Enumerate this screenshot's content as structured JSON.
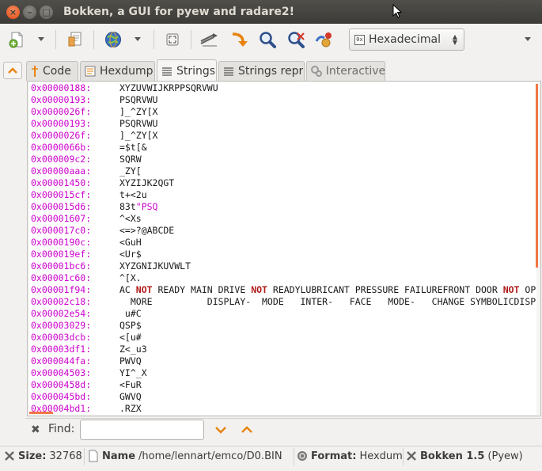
{
  "window": {
    "title": "Bokken, a GUI for pyew and radare2!"
  },
  "toolbar": {
    "format_combo": {
      "icon_text": "0x",
      "selected": "Hexadecimal"
    }
  },
  "tabs": [
    {
      "label": "Code",
      "icon": "code-icon",
      "active": false,
      "disabled": false
    },
    {
      "label": "Hexdump",
      "icon": "hexdump-icon",
      "active": false,
      "disabled": false
    },
    {
      "label": "Strings",
      "icon": "strings-icon",
      "active": true,
      "disabled": false
    },
    {
      "label": "Strings repr",
      "icon": "strings-repr-icon",
      "active": false,
      "disabled": false
    },
    {
      "label": "Interactive",
      "icon": "interactive-icon",
      "active": false,
      "disabled": true
    }
  ],
  "strings": [
    {
      "addr": "0x00000188:",
      "value": "XYZUVWIJKRPPSQRVWU"
    },
    {
      "addr": "0x00000193:",
      "value": "PSQRVWU"
    },
    {
      "addr": "0x0000026f:",
      "value": "]_^ZY[X"
    },
    {
      "addr": "0x00000193:",
      "value": "PSQRVWU"
    },
    {
      "addr": "0x0000026f:",
      "value": "]_^ZY[X"
    },
    {
      "addr": "0x0000066b:",
      "value": "=$t[&"
    },
    {
      "addr": "0x000009c2:",
      "value": "SQRW"
    },
    {
      "addr": "0x00000aaa:",
      "value": "_ZY["
    },
    {
      "addr": "0x00001450:",
      "value": "XYZIJK2QGT"
    },
    {
      "addr": "0x000015cf:",
      "value": "t+<2u"
    },
    {
      "addr": "0x000015d6:",
      "value": "83t",
      "highlight": "\"PSQ"
    },
    {
      "addr": "0x00001607:",
      "value": "^<Xs"
    },
    {
      "addr": "0x000017c0:",
      "value": "<=>?@ABCDE"
    },
    {
      "addr": "0x0000190c:",
      "value": "<GuH"
    },
    {
      "addr": "0x000019ef:",
      "value": "<Ur$"
    },
    {
      "addr": "0x00001bc6:",
      "value": "XYZGNIJKUVWLT"
    },
    {
      "addr": "0x00001c60:",
      "value": "^[X."
    },
    {
      "addr": "0x00001f94:",
      "segments": [
        "AC ",
        "NOT",
        " READY MAIN DRIVE ",
        "NOT",
        " READYLUBRICANT PRESSURE FAILUREFRONT DOOR ",
        "NOT",
        " OPEN"
      ]
    },
    {
      "addr": "0x00002c18:",
      "value": "  MORE          DISPLAY-  MODE   INTER-   FACE   MODE-   CHANGE SYMBOLICDISPLAY"
    },
    {
      "addr": "0x00002e54:",
      "value": " u#C"
    },
    {
      "addr": "0x00003029:",
      "value": "QSP$"
    },
    {
      "addr": "0x00003dcb:",
      "value": "<[u#"
    },
    {
      "addr": "0x00003df1:",
      "value": "Z<_u3"
    },
    {
      "addr": "0x000044fa:",
      "value": "PWVQ"
    },
    {
      "addr": "0x00004503:",
      "value": "YI^_X"
    },
    {
      "addr": "0x0000458d:",
      "value": "<FuR"
    },
    {
      "addr": "0x000045bd:",
      "value": "GWVQ"
    },
    {
      "addr": "0x00004bd1:",
      "value": ".RZX"
    }
  ],
  "find": {
    "label": "Find:",
    "value": ""
  },
  "status": {
    "size_label": "Size:",
    "size_value": "32768",
    "name_label": "Name",
    "name_value": "/home/lennart/emco/D0.BIN",
    "format_label": "Format:",
    "format_value": "Hexdum",
    "app_label": "Bokken 1.5",
    "app_value": "(Pyew)"
  },
  "colors": {
    "address": "#cc00cc",
    "keyword": "#b01818",
    "accent": "#f07746"
  }
}
